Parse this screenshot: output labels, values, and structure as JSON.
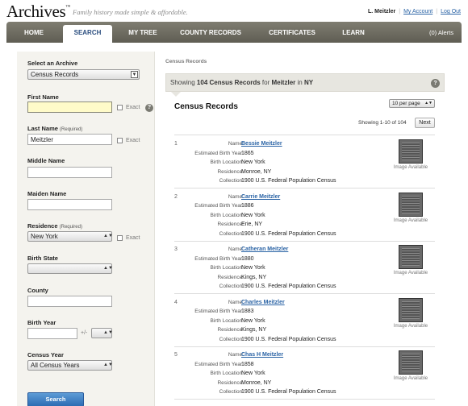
{
  "header": {
    "logo": "Archives",
    "logo_tm": "™",
    "tagline": "Family history made simple & affordable.",
    "user": "L. Meitzler",
    "links": [
      "My Account",
      "Log Out"
    ]
  },
  "nav": {
    "tabs": [
      "HOME",
      "SEARCH",
      "MY TREE",
      "COUNTY RECORDS",
      "CERTIFICATES",
      "LEARN"
    ],
    "active": "SEARCH",
    "alerts": "(0) Alerts"
  },
  "form": {
    "archive_label": "Select an Archive",
    "archive_value": "Census Records",
    "first_name_label": "First Name",
    "first_name_value": "",
    "exact_label": "Exact",
    "last_name_label": "Last Name",
    "required": "(Required)",
    "last_name_value": "Meitzler",
    "middle_name_label": "Middle Name",
    "maiden_name_label": "Maiden Name",
    "residence_label": "Residence",
    "residence_value": "New York",
    "birth_state_label": "Birth State",
    "county_label": "County",
    "birth_year_label": "Birth Year",
    "plus_minus": "+/-",
    "census_year_label": "Census Year",
    "census_year_value": "All Census Years",
    "search_button": "Search"
  },
  "results": {
    "breadcrumb": "Census Records",
    "showing_prefix": "Showing",
    "count": "104",
    "showing_mid": "Census Records",
    "showing_for": "for",
    "query_name": "Meitzler",
    "showing_in": "in",
    "query_place": "NY",
    "title": "Census Records",
    "per_page": "10 per page",
    "page_info": "Showing 1-10 of 104",
    "next": "Next",
    "field_labels": {
      "name": "Name:",
      "birth_year": "Estimated Birth Year:",
      "birth_location": "Birth Location:",
      "residence": "Residence:",
      "collection": "Collection:"
    },
    "image_available": "Image Available",
    "records": [
      {
        "num": "1",
        "name": "Bessie Meitzler",
        "birth_year": "1865",
        "birth_location": "New York",
        "residence": "Monroe, NY",
        "collection": "1900 U.S. Federal Population Census"
      },
      {
        "num": "2",
        "name": "Carrie Meitzler",
        "birth_year": "1886",
        "birth_location": "New York",
        "residence": "Erie, NY",
        "collection": "1900 U.S. Federal Population Census"
      },
      {
        "num": "3",
        "name": "Catheran Meitzler",
        "birth_year": "1880",
        "birth_location": "New York",
        "residence": "Kings, NY",
        "collection": "1900 U.S. Federal Population Census"
      },
      {
        "num": "4",
        "name": "Charles Meitzler",
        "birth_year": "1883",
        "birth_location": "New York",
        "residence": "Kings, NY",
        "collection": "1900 U.S. Federal Population Census"
      },
      {
        "num": "5",
        "name": "Chas H Meitzler",
        "birth_year": "1858",
        "birth_location": "New York",
        "residence": "Monroe, NY",
        "collection": "1900 U.S. Federal Population Census"
      }
    ]
  }
}
